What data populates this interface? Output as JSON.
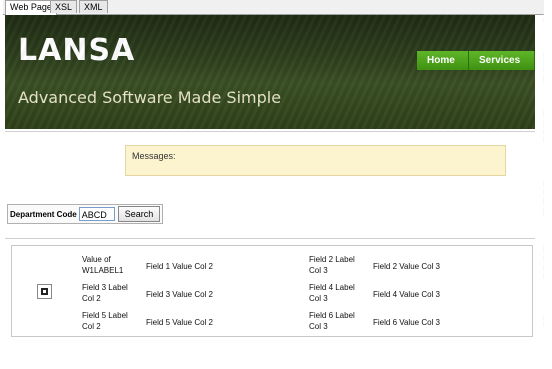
{
  "tabs": [
    {
      "label": "Web Page",
      "active": true
    },
    {
      "label": "XSL",
      "active": false
    },
    {
      "label": "XML",
      "active": false
    }
  ],
  "header": {
    "brand": "LANSA",
    "tagline": "Advanced Software Made Simple"
  },
  "nav": {
    "home": "Home",
    "services": "Services"
  },
  "messages": {
    "label": "Messages:"
  },
  "search": {
    "label": "Department Code",
    "value": "ABCD",
    "button": "Search"
  },
  "grid": {
    "rows": [
      {
        "col2_label": "Value of W1LABEL1",
        "col2_value": "Field 1 Value Col 2",
        "col3_label": "Field 2 Label Col 3",
        "col3_value": "Field 2 Value Col 3"
      },
      {
        "col2_label": "Field 3 Label Col 2",
        "col2_value": "Field 3 Value Col 2",
        "col3_label": "Field 4 Label Col 3",
        "col3_value": "Field 4 Value Col 3"
      },
      {
        "col2_label": "Field 5 Label Col 2",
        "col2_value": "Field 5 Value Col 2",
        "col3_label": "Field 6 Label Col 3",
        "col3_value": "Field 6 Value Col 3"
      }
    ]
  },
  "colors": {
    "banner": "#2c3d1c",
    "nav_green": "#4fa31c",
    "messages_bg": "#fcf3cf"
  }
}
